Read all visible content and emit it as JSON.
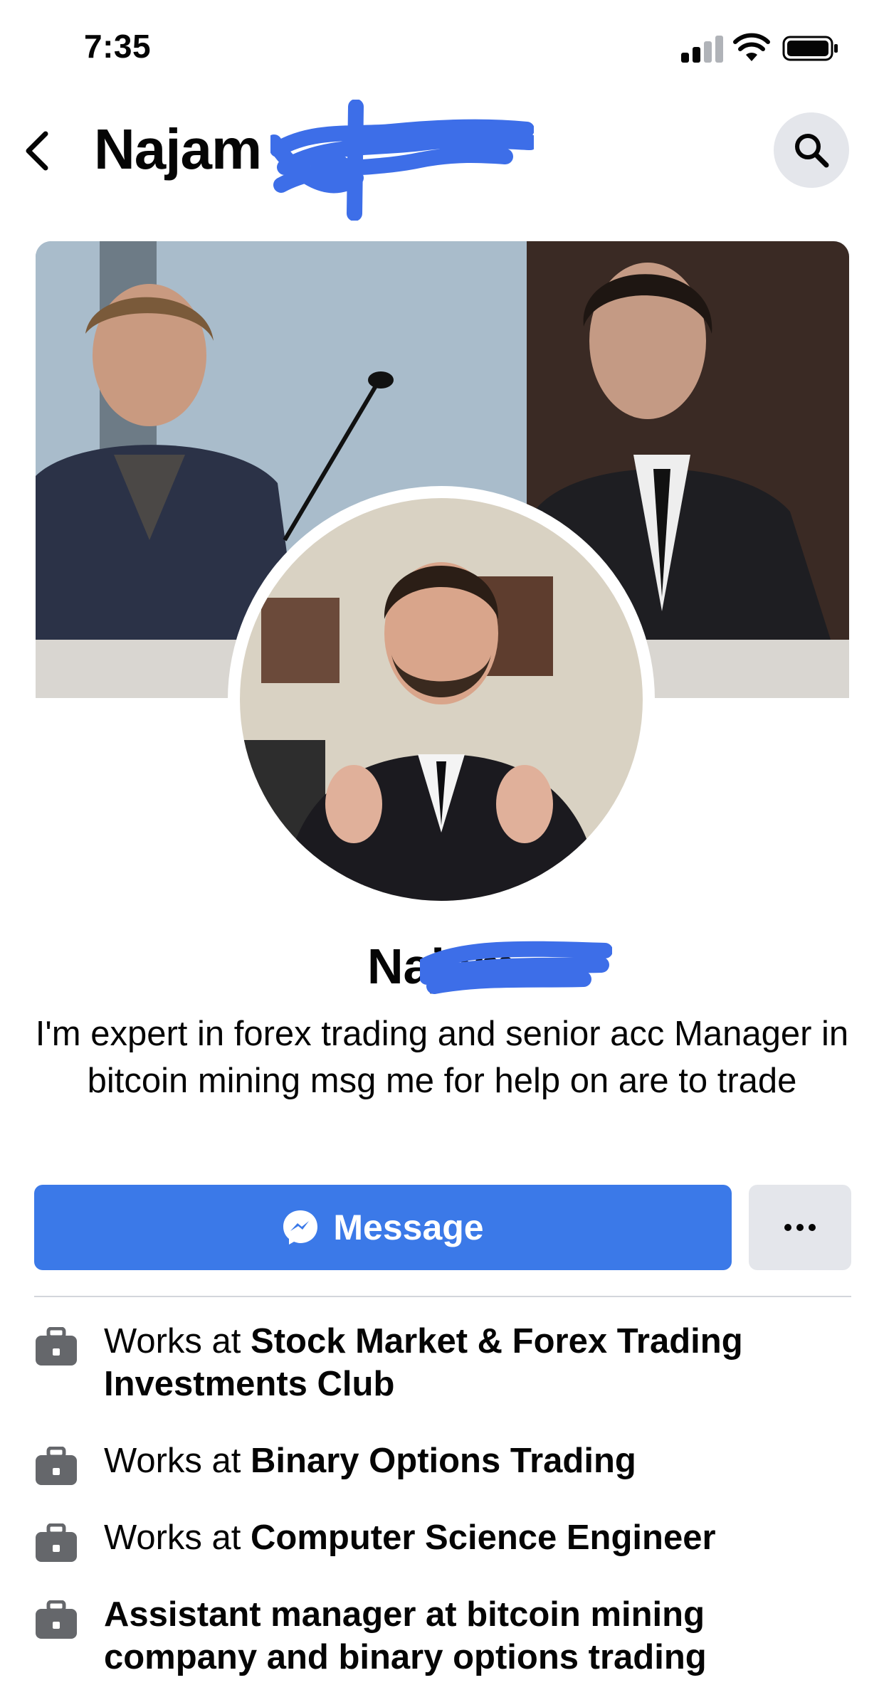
{
  "status_bar": {
    "time": "7:35"
  },
  "header": {
    "title": "Najam"
  },
  "profile": {
    "name": "Najam",
    "bio": "I'm expert in forex trading and senior acc Manager in bitcoin mining msg me for help on are to trade"
  },
  "actions": {
    "message_label": "Message"
  },
  "work": [
    {
      "prefix": "Works at ",
      "place": "Stock Market & Forex Trading Investments Club"
    },
    {
      "prefix": "Works at ",
      "place": "Binary Options Trading"
    },
    {
      "prefix": "Works at ",
      "place": "Computer Science Engineer"
    },
    {
      "prefix": "",
      "place": "Assistant manager at bitcoin mining company and binary options trading"
    }
  ],
  "colors": {
    "accent": "#3b79e8",
    "redaction": "#3d6ee8",
    "secondary_bg": "#e4e6eb",
    "text": "#050505"
  },
  "icons": [
    "back-arrow-icon",
    "search-icon",
    "messenger-icon",
    "more-dots-icon",
    "briefcase-icon",
    "signal-icon",
    "wifi-icon",
    "battery-icon"
  ]
}
